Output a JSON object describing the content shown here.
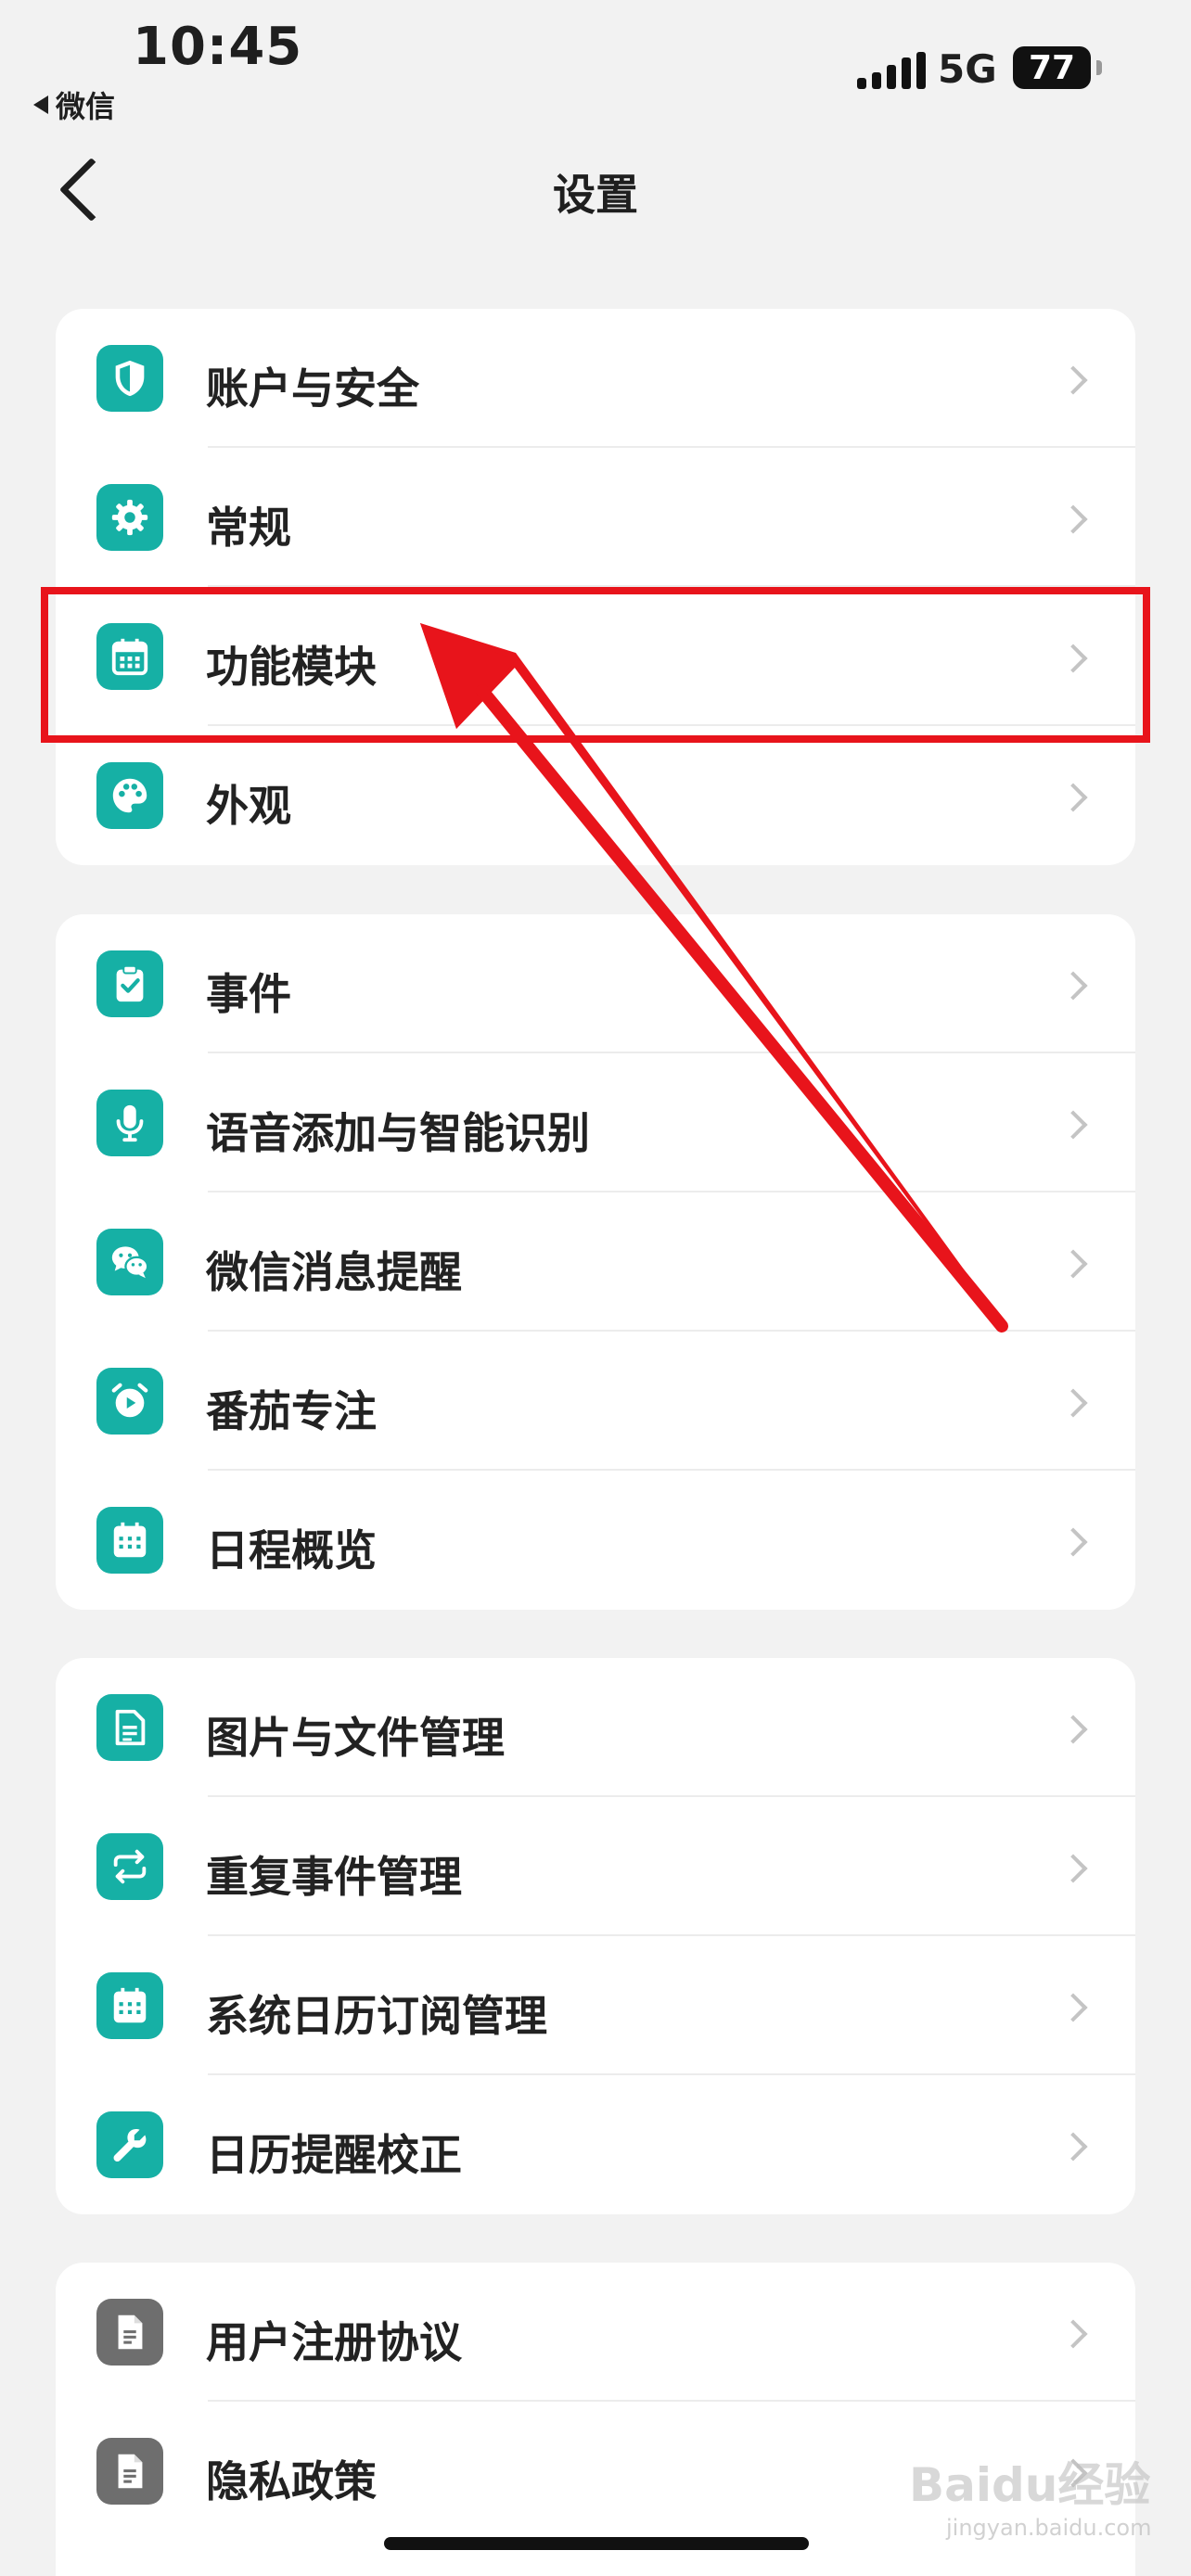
{
  "status_bar": {
    "time": "10:45",
    "back_app": "微信",
    "network": "5G",
    "battery": "77"
  },
  "nav": {
    "title": "设置"
  },
  "groups": [
    {
      "items": [
        {
          "label": "账户与安全",
          "icon": "shield-icon"
        },
        {
          "label": "常规",
          "icon": "gear-icon"
        },
        {
          "label": "功能模块",
          "icon": "calendar-icon"
        },
        {
          "label": "外观",
          "icon": "palette-icon"
        }
      ]
    },
    {
      "items": [
        {
          "label": "事件",
          "icon": "clipboard-check-icon"
        },
        {
          "label": "语音添加与智能识别",
          "icon": "microphone-icon"
        },
        {
          "label": "微信消息提醒",
          "icon": "wechat-icon"
        },
        {
          "label": "番茄专注",
          "icon": "alarm-clock-icon"
        },
        {
          "label": "日程概览",
          "icon": "calendar-grid-icon"
        }
      ]
    },
    {
      "items": [
        {
          "label": "图片与文件管理",
          "icon": "document-icon"
        },
        {
          "label": "重复事件管理",
          "icon": "repeat-icon"
        },
        {
          "label": "系统日历订阅管理",
          "icon": "calendar-grid-icon"
        },
        {
          "label": "日历提醒校正",
          "icon": "wrench-icon"
        }
      ]
    },
    {
      "items": [
        {
          "label": "用户注册协议",
          "icon": "file-icon"
        },
        {
          "label": "隐私政策",
          "icon": "file-icon"
        }
      ]
    }
  ],
  "watermark": {
    "text": "Baidu经验",
    "sub": "jingyan.baidu.com"
  }
}
